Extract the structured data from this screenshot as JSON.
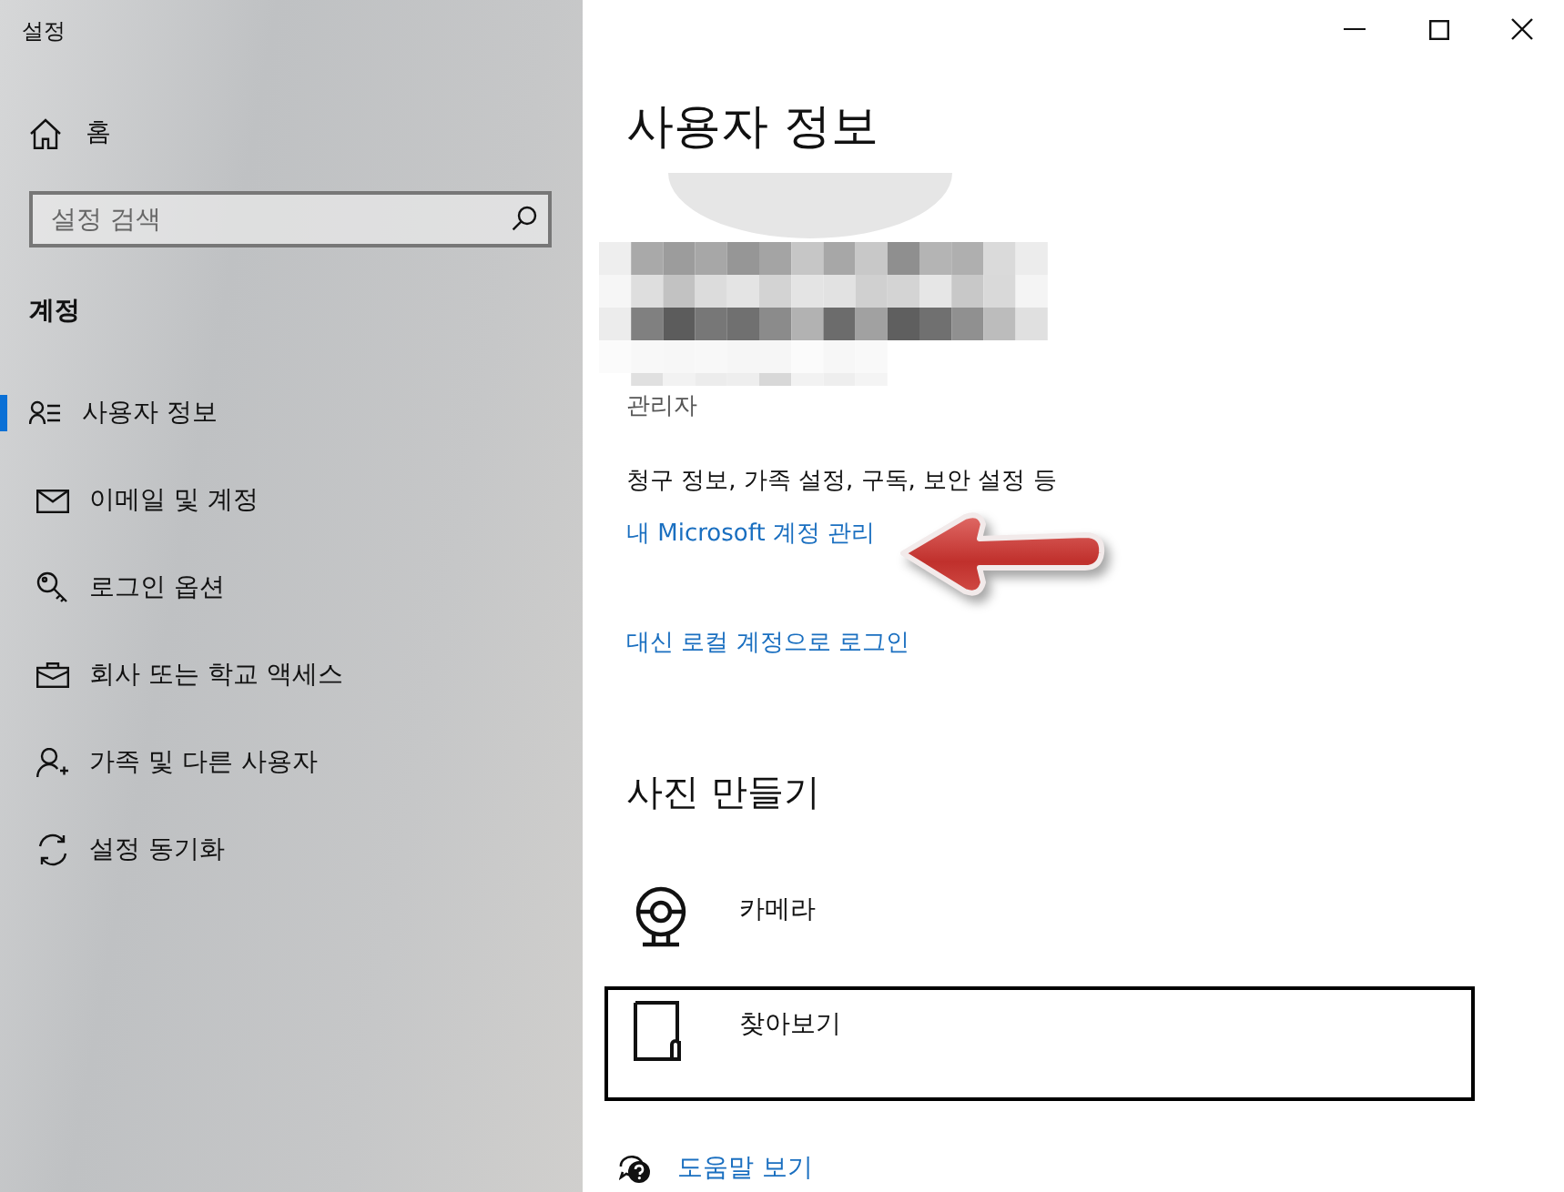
{
  "window": {
    "title": "설정"
  },
  "sidebar": {
    "home": "홈",
    "search": {
      "placeholder": "설정 검색"
    },
    "section": "계정",
    "items": [
      {
        "label": "사용자 정보",
        "selected": true
      },
      {
        "label": "이메일 및 계정",
        "selected": false
      },
      {
        "label": "로그인 옵션",
        "selected": false
      },
      {
        "label": "회사 또는 학교 액세스",
        "selected": false
      },
      {
        "label": "가족 및 다른 사용자",
        "selected": false
      },
      {
        "label": "설정 동기화",
        "selected": false
      }
    ]
  },
  "main": {
    "title": "사용자 정보",
    "role": "관리자",
    "info": "청구 정보, 가족 설정, 구독, 보안 설정 등",
    "links": [
      "내 Microsoft 계정 관리",
      "대신 로컬 계정으로 로그인"
    ],
    "section": "사진 만들기",
    "photo_options": [
      {
        "label": "카메라",
        "focused": false
      },
      {
        "label": "찾아보기",
        "focused": true
      }
    ],
    "help": "도움말 보기"
  }
}
